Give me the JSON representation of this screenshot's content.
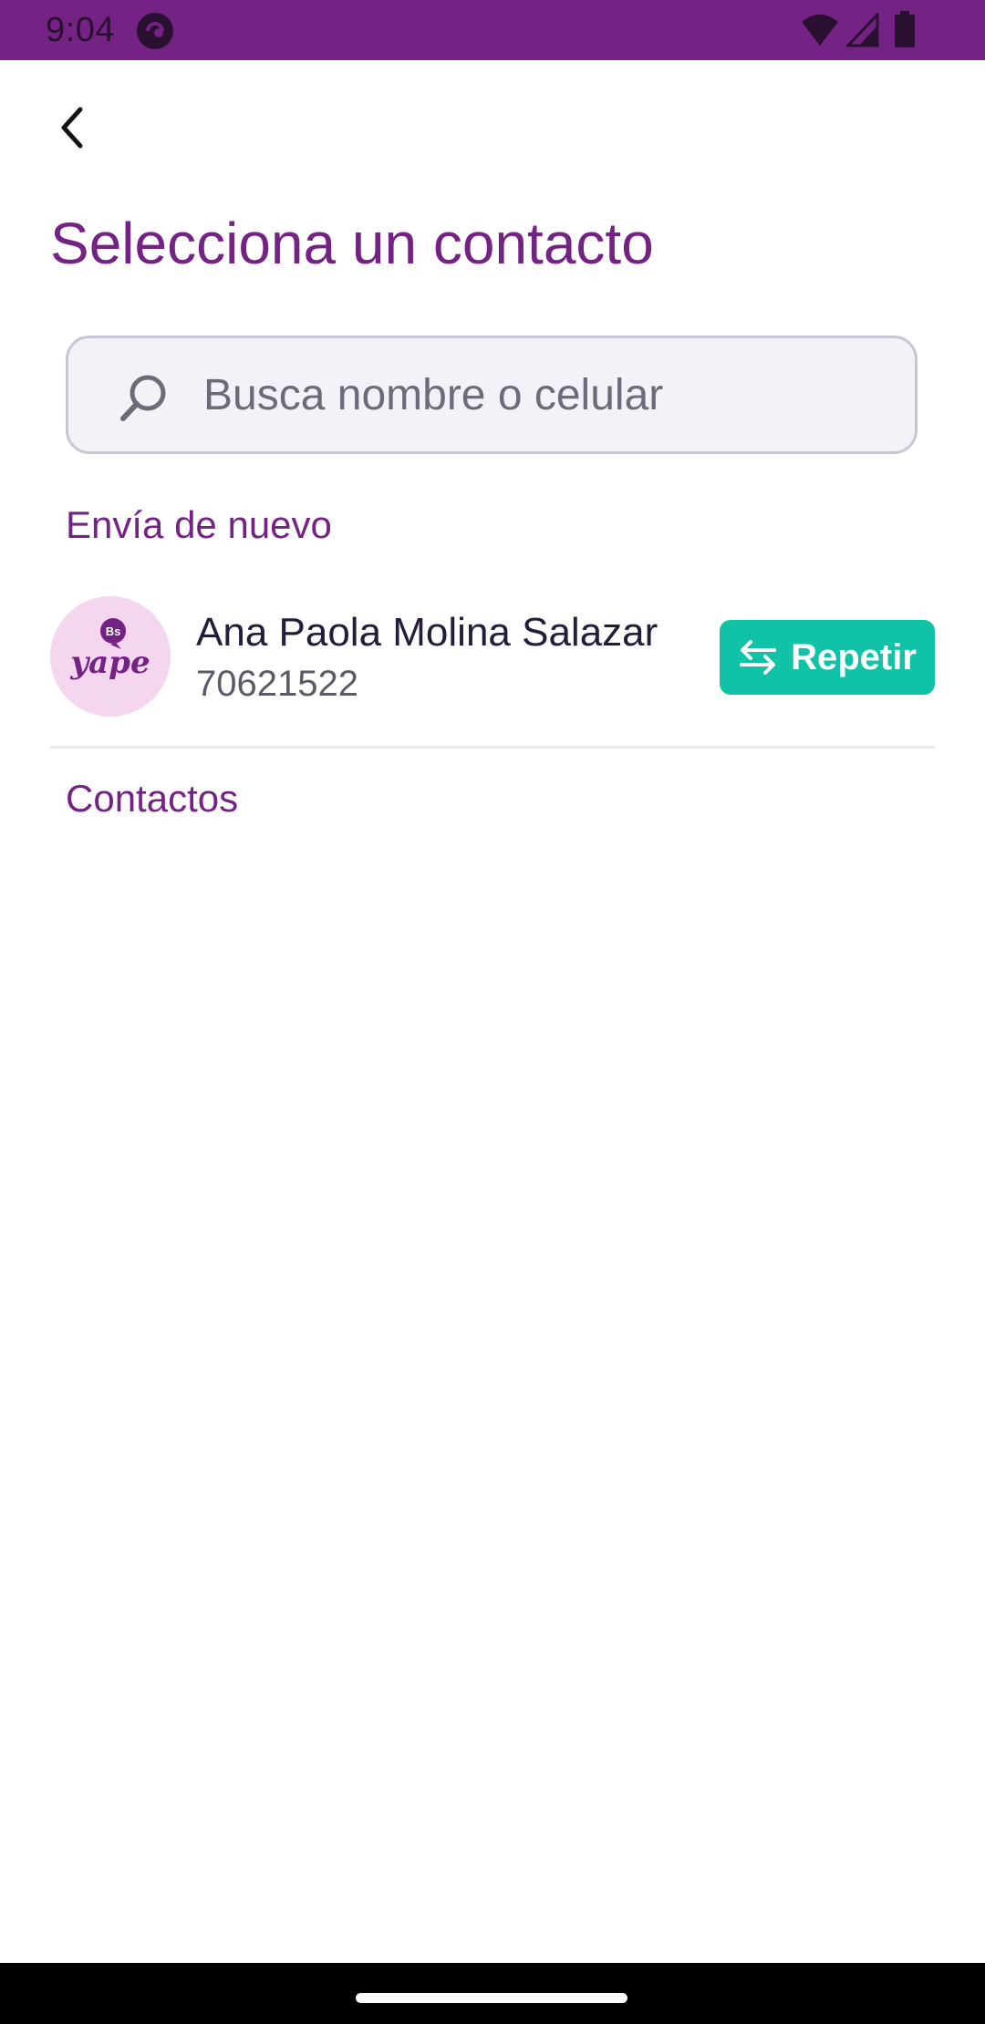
{
  "status_bar": {
    "time": "9:04",
    "background_color": "#742283",
    "icons": [
      "app-notification-icon",
      "wifi-icon",
      "signal-icon",
      "battery-icon"
    ]
  },
  "header": {
    "back_icon": "chevron-left-icon",
    "title": "Selecciona un contacto"
  },
  "search": {
    "placeholder": "Busca nombre o celular",
    "value": "",
    "icon": "search-icon"
  },
  "recent": {
    "section_title": "Envía de nuevo",
    "contacts": [
      {
        "name": "Ana Paola Molina Salazar",
        "phone": "70621522",
        "avatar_logo": "yape",
        "avatar_badge": "Bs",
        "action_label": "Repetir",
        "action_icon": "swap-arrows-icon"
      }
    ]
  },
  "contacts": {
    "section_title": "Contactos",
    "items": []
  },
  "colors": {
    "brand_purple": "#742283",
    "accent_teal": "#11c3a6",
    "avatar_bg": "#f4d7ef",
    "search_bg": "#f3f2f8"
  }
}
